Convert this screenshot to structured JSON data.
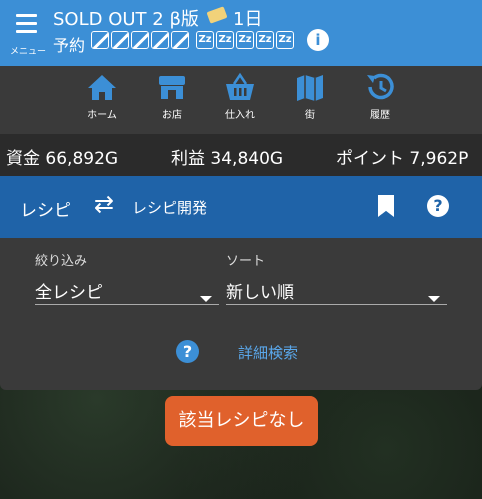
{
  "header": {
    "menu_label": "メニュー",
    "title": "SOLD OUT 2 β版",
    "day": "1日",
    "reserve_label": "予約",
    "z_glyph": "Zz"
  },
  "nav": [
    {
      "label": "ホーム",
      "icon": "home-icon"
    },
    {
      "label": "お店",
      "icon": "store-icon"
    },
    {
      "label": "仕入れ",
      "icon": "basket-icon"
    },
    {
      "label": "街",
      "icon": "map-icon"
    },
    {
      "label": "履歴",
      "icon": "history-icon"
    }
  ],
  "stats": {
    "funds": "資金 66,892G",
    "profit": "利益 34,840G",
    "points": "ポイント 7,962P"
  },
  "recipe_bar": {
    "recipe": "レシピ",
    "develop": "レシピ開発"
  },
  "filter": {
    "narrow_label": "絞り込み",
    "narrow_value": "全レシピ",
    "sort_label": "ソート",
    "sort_value": "新しい順",
    "advanced_search": "詳細検索"
  },
  "result": {
    "empty_label": "該当レシピなし"
  }
}
